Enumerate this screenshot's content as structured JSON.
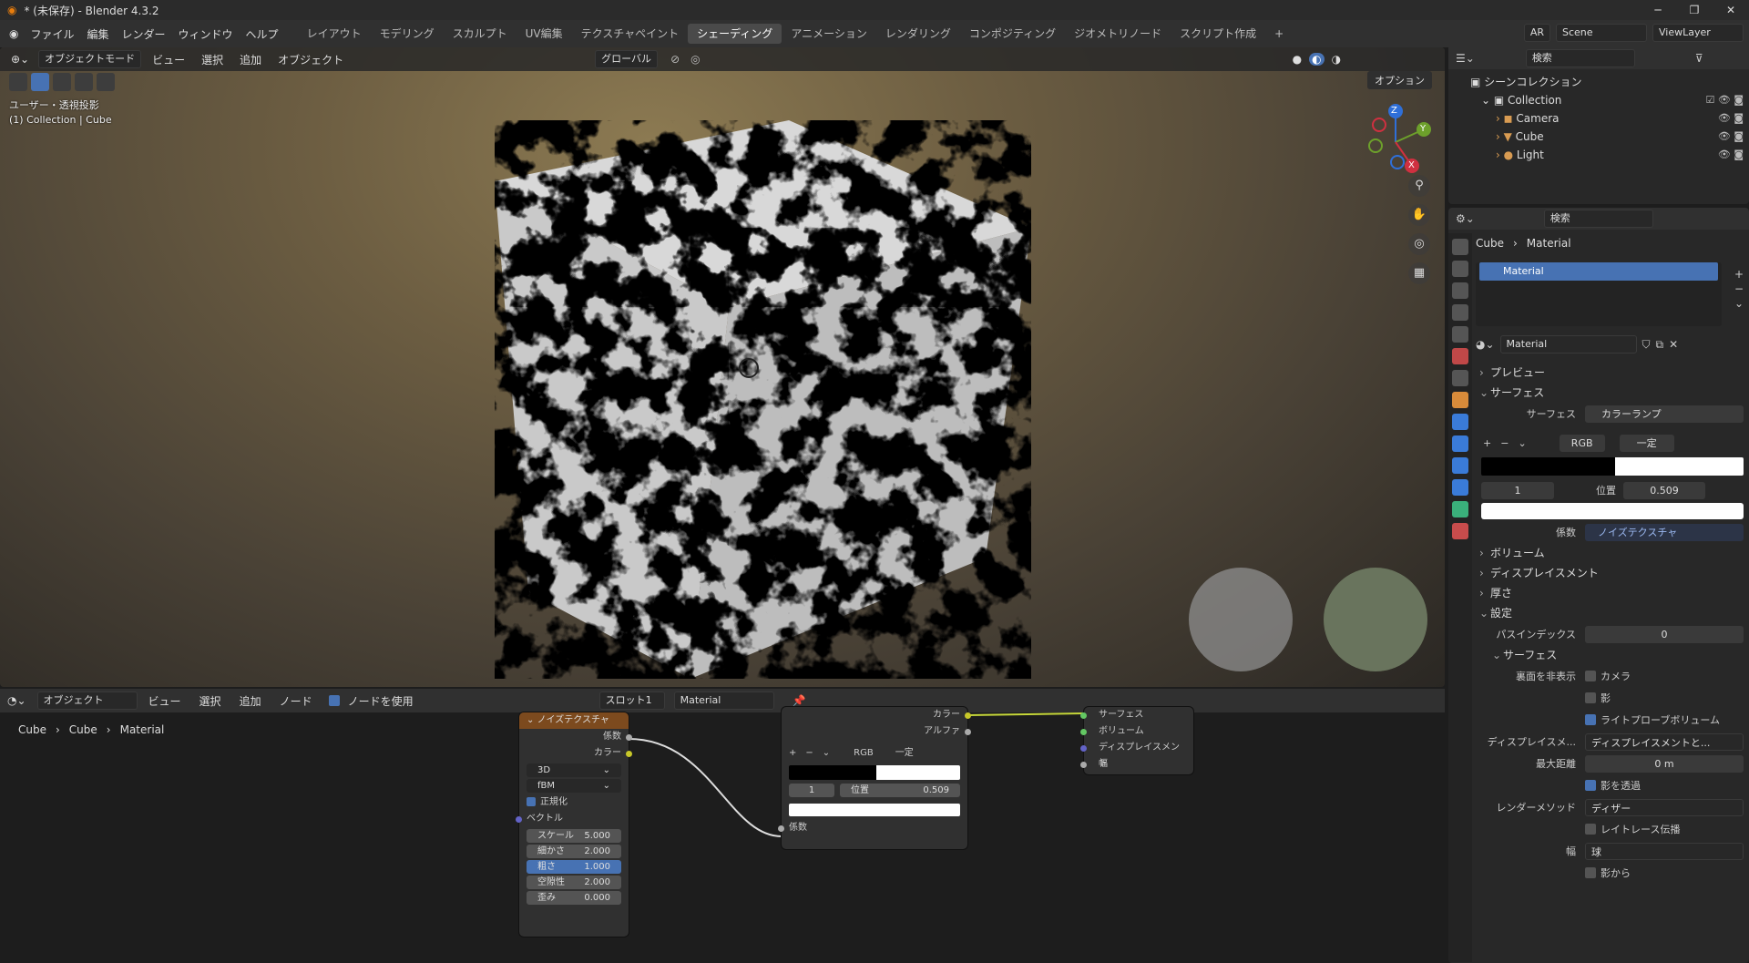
{
  "app": {
    "title": "* (未保存) - Blender 4.3.2"
  },
  "menu": [
    "ファイル",
    "編集",
    "レンダー",
    "ウィンドウ",
    "ヘルプ"
  ],
  "workspaces": [
    "レイアウト",
    "モデリング",
    "スカルプト",
    "UV編集",
    "テクスチャペイント",
    "シェーディング",
    "アニメーション",
    "レンダリング",
    "コンポジティング",
    "ジオメトリノード",
    "スクリプト作成"
  ],
  "workspace_add": "+",
  "header_right": {
    "ar": "AR",
    "scene": "Scene",
    "view_layer": "ViewLayer"
  },
  "viewport": {
    "mode": "オブジェクトモード",
    "menu": [
      "ビュー",
      "選択",
      "追加",
      "オブジェクト"
    ],
    "transform": "グローバル",
    "options": "オプション",
    "overlay_line1": "ユーザー・透視投影",
    "overlay_line2": "(1) Collection | Cube",
    "gizmo": {
      "x": "X",
      "y": "Y",
      "z": "Z"
    }
  },
  "outliner": {
    "search_placeholder": "検索",
    "scene_collection": "シーンコレクション",
    "collection": "Collection",
    "items": [
      "Camera",
      "Cube",
      "Light"
    ]
  },
  "properties": {
    "search_placeholder": "検索",
    "breadcrumb": [
      "Cube",
      "Material"
    ],
    "slot": "Material",
    "material_name": "Material",
    "sections": {
      "preview": "プレビュー",
      "surface": "サーフェス",
      "volume": "ボリューム",
      "displacement": "ディスプレイスメント",
      "thickness": "厚さ",
      "settings": "設定"
    },
    "surface_label": "サーフェス",
    "surface_value": "カラーランプ",
    "ramp": {
      "mode": "RGB",
      "interp": "一定",
      "index": "1",
      "pos_label": "位置",
      "pos_value": "0.509",
      "fac_label": "係数",
      "fac_value": "ノイズテクスチャ"
    },
    "settings": {
      "pass_index_label": "パスインデックス",
      "pass_index": "0",
      "sub_surface": "サーフェス",
      "backface_label": "裏面を非表示",
      "camera": "カメラ",
      "shadow": "影",
      "light_probe": "ライトプローブボリューム",
      "disp_label": "ディスプレイスメ...",
      "disp_value": "ディスプレイスメントと...",
      "max_dist_label": "最大距離",
      "max_dist": "0 m",
      "shadow_through": "影を透過",
      "render_method_label": "レンダーメソッド",
      "render_method": "ディザー",
      "raytrace": "レイトレース伝播",
      "width_label": "幅",
      "width_value": "球",
      "from_shadow": "影から"
    },
    "controls": {
      "plus": "+",
      "minus": "−",
      "down": "⌄"
    }
  },
  "node_editor": {
    "type": "オブジェクト",
    "menu": [
      "ビュー",
      "選択",
      "追加",
      "ノード"
    ],
    "use_nodes": "ノードを使用",
    "slot": "スロット1",
    "material": "Material",
    "breadcrumb": [
      "Cube",
      "Cube",
      "Material"
    ],
    "noise": {
      "title": "ノイズテクスチャ",
      "out_fac": "係数",
      "out_color": "カラー",
      "dim": "3D",
      "type": "fBM",
      "normalize": "正規化",
      "vector": "ベクトル",
      "fields": [
        {
          "label": "スケール",
          "value": "5.000"
        },
        {
          "label": "細かさ",
          "value": "2.000"
        },
        {
          "label": "粗さ",
          "value": "1.000"
        },
        {
          "label": "空隙性",
          "value": "2.000"
        },
        {
          "label": "歪み",
          "value": "0.000"
        }
      ]
    },
    "ramp_node": {
      "color_out": "カラー",
      "alpha_out": "アルファ",
      "mode": "RGB",
      "interp": "一定",
      "index": "1",
      "pos_label": "位置",
      "pos_value": "0.509",
      "fac_in": "係数"
    },
    "output_node": {
      "rows": [
        "サーフェス",
        "ボリューム",
        "ディスプレイスメント",
        "幅"
      ]
    }
  },
  "colors": {
    "accent": "#4772b3",
    "noise_header": "#7c4a1e",
    "ramp_header": "#3c3c83"
  }
}
